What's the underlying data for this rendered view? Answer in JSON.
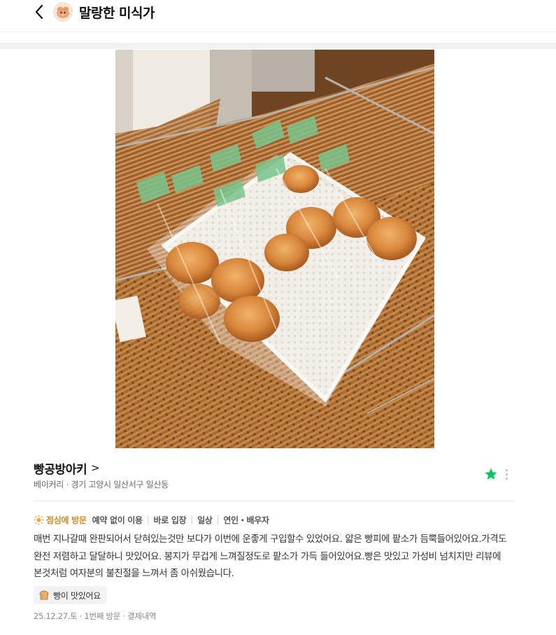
{
  "header": {
    "back_icon": "chevron-left-icon",
    "profile_name": "말랑한 미식가",
    "avatar_icon": "avatar-icon"
  },
  "photo": {
    "alt": "",
    "icon": "bread-photo"
  },
  "place": {
    "name": "빵공방아키",
    "arrow": ">",
    "category": "베이커리",
    "separator": " · ",
    "address": "경기 고양시 일산서구 일산동",
    "star_color": "#03c75a"
  },
  "visit_info": {
    "time": "점심에 방문",
    "tags": [
      "예약 없이 이용",
      "바로 입장",
      "일상",
      "연인・배우자"
    ],
    "time_color": "#d18b1e"
  },
  "review": {
    "text": "매번 지나갈때 완판되어서 닫혀있는것만 보다가 이번에 운좋게 구입할수 있었어요. 얇은 빵피에 팥소가 듬뿍들어있어요.가격도 완전 저렴하고 달달하니 맛있어요. 봉지가 무겁게 느껴질정도로 팥소가 가득 들어있어요.빵은 맛있고 가성비 넘치지만 리뷰에 본것처럼 여자분의 불친절을 느껴서 좀 아쉬웠습니다."
  },
  "keyword": {
    "icon": "bread-icon",
    "label": "빵이 맛있어요"
  },
  "visit_meta": {
    "date": "25.12.27.토",
    "count": "1번째 방문",
    "receipt": "결제내역",
    "separator": " · "
  }
}
